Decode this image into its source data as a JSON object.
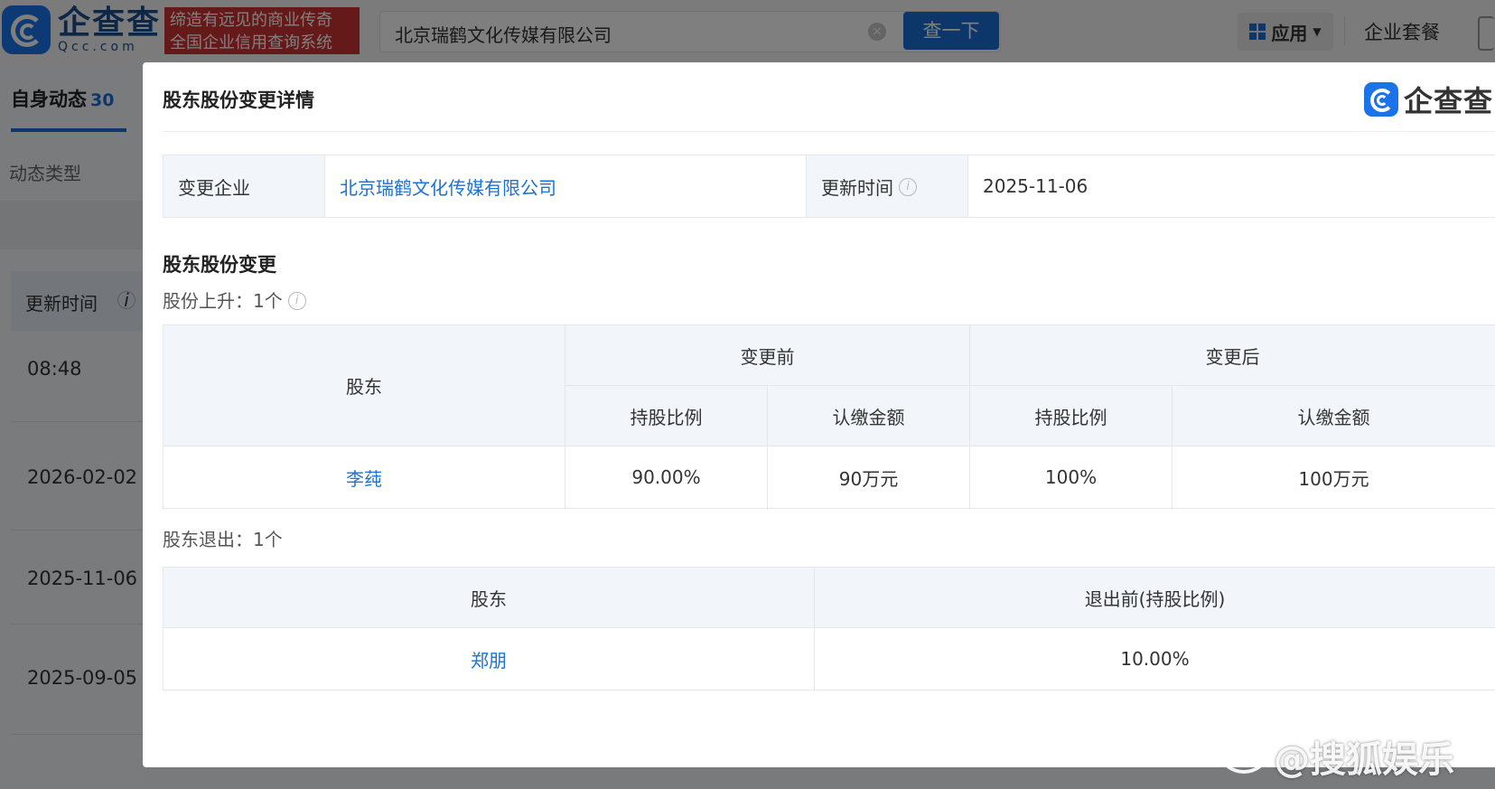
{
  "header": {
    "logo_cn": "企查查",
    "logo_en": "Qcc.com",
    "slogan_line1": "缔造有远见的商业传奇",
    "slogan_line2": "全国企业信用查询系统",
    "search_value": "北京瑞鹤文化传媒有限公司",
    "search_button": "查一下",
    "apps_button": "应用",
    "package_link": "企业套餐",
    "brand_color": "#1a6fd6"
  },
  "sidebar": {
    "tab_label": "自身动态",
    "tab_count": "30",
    "filter_label": "动态类型",
    "time_header": "更新时间",
    "rows": [
      "08:48",
      "2026-02-02",
      "2025-11-06",
      "2025-09-05"
    ]
  },
  "modal": {
    "title": "股东股份变更详情",
    "logo_text": "企查查",
    "info": {
      "company_label": "变更企业",
      "company_value": "北京瑞鹤文化传媒有限公司",
      "update_label": "更新时间",
      "update_value": "2025-11-06"
    },
    "section_title": "股东股份变更",
    "increase_label": "股份上升：1个",
    "share_table": {
      "col_shareholder": "股东",
      "col_before": "变更前",
      "col_after": "变更后",
      "sub_ratio": "持股比例",
      "sub_amount": "认缴金额",
      "rows": [
        {
          "name": "李莼",
          "before_ratio": "90.00%",
          "before_amount": "90万元",
          "after_ratio": "100%",
          "after_amount": "100万元"
        }
      ]
    },
    "exit_label": "股东退出：1个",
    "exit_table": {
      "col_shareholder": "股东",
      "col_before_exit": "退出前(持股比例)",
      "rows": [
        {
          "name": "郑朋",
          "ratio": "10.00%"
        }
      ]
    }
  },
  "watermark": "@搜狐娱乐"
}
